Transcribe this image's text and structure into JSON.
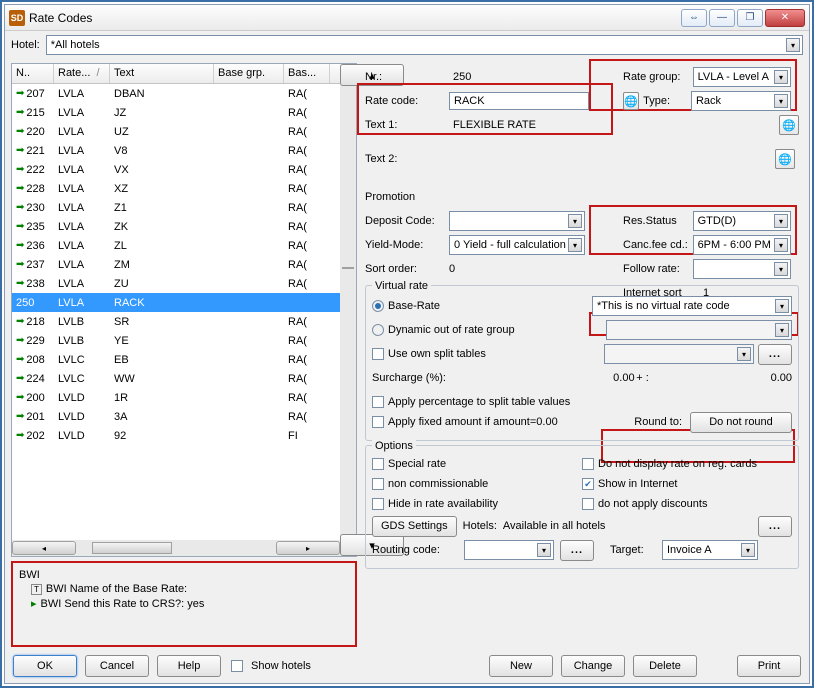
{
  "window": {
    "title": "Rate Codes"
  },
  "toolbar": {
    "hotel_label": "Hotel:",
    "hotel_value": "*All hotels"
  },
  "list": {
    "headers": {
      "nr": "N..",
      "rate": "Rate...",
      "sort": "/",
      "text": "Text",
      "basegrp": "Base grp.",
      "bas": "Bas..."
    },
    "rows": [
      {
        "nr": "207",
        "rate": "LVLA",
        "text": "DBAN",
        "bas": "RA("
      },
      {
        "nr": "215",
        "rate": "LVLA",
        "text": "JZ",
        "bas": "RA("
      },
      {
        "nr": "220",
        "rate": "LVLA",
        "text": "UZ",
        "bas": "RA("
      },
      {
        "nr": "221",
        "rate": "LVLA",
        "text": "V8",
        "bas": "RA("
      },
      {
        "nr": "222",
        "rate": "LVLA",
        "text": "VX",
        "bas": "RA("
      },
      {
        "nr": "228",
        "rate": "LVLA",
        "text": "XZ",
        "bas": "RA("
      },
      {
        "nr": "230",
        "rate": "LVLA",
        "text": "Z1",
        "bas": "RA("
      },
      {
        "nr": "235",
        "rate": "LVLA",
        "text": "ZK",
        "bas": "RA("
      },
      {
        "nr": "236",
        "rate": "LVLA",
        "text": "ZL",
        "bas": "RA("
      },
      {
        "nr": "237",
        "rate": "LVLA",
        "text": "ZM",
        "bas": "RA("
      },
      {
        "nr": "238",
        "rate": "LVLA",
        "text": "ZU",
        "bas": "RA("
      },
      {
        "nr": "250",
        "rate": "LVLA",
        "text": "RACK",
        "bas": "",
        "selected": true
      },
      {
        "nr": "218",
        "rate": "LVLB",
        "text": "SR",
        "bas": "RA("
      },
      {
        "nr": "229",
        "rate": "LVLB",
        "text": "YE",
        "bas": "RA("
      },
      {
        "nr": "208",
        "rate": "LVLC",
        "text": "EB",
        "bas": "RA("
      },
      {
        "nr": "224",
        "rate": "LVLC",
        "text": "WW",
        "bas": "RA("
      },
      {
        "nr": "200",
        "rate": "LVLD",
        "text": "1R",
        "bas": "RA("
      },
      {
        "nr": "201",
        "rate": "LVLD",
        "text": "3A",
        "bas": "RA("
      },
      {
        "nr": "202",
        "rate": "LVLD",
        "text": "92",
        "bas": "FI"
      }
    ]
  },
  "bwi": {
    "title": "BWI",
    "name_label": "BWI Name of the Base Rate:",
    "send_label": "BWI Send this Rate to CRS?: yes"
  },
  "form": {
    "nr_label": "Nr.:",
    "nr_value": "250",
    "rate_code_label": "Rate code:",
    "rate_code_value": "RACK",
    "text1_label": "Text 1:",
    "text1_value": "FLEXIBLE RATE",
    "text2_label": "Text 2:",
    "promotion_label": "Promotion",
    "deposit_label": "Deposit Code:",
    "yield_label": "Yield-Mode:",
    "yield_value": "0 Yield - full calculation",
    "sort_label": "Sort order:",
    "sort_value": "0",
    "rate_group_label": "Rate group:",
    "rate_group_value": "LVLA  - Level A",
    "type_label": "Type:",
    "type_value": "Rack",
    "res_status_label": "Res.Status",
    "res_status_value": "GTD(D)",
    "canc_fee_label": "Canc.fee cd.:",
    "canc_fee_value": "6PM  - 6:00 PM",
    "follow_rate_label": "Follow rate:",
    "internet_sort_label": "Internet sort",
    "internet_sort_value": "1"
  },
  "virtual": {
    "legend": "Virtual rate",
    "base_rate": "Base-Rate",
    "dynamic": "Dynamic out of rate group",
    "own_split": "Use own split tables",
    "surcharge_label": "Surcharge (%):",
    "surcharge_value": "0.00",
    "surcharge_plus": "+ :",
    "surcharge_plus_value": "0.00",
    "apply_pct": "Apply percentage to split table values",
    "apply_fixed": "Apply fixed amount if amount=0.00",
    "virtual_combo": "*This is no virtual rate code",
    "round_label": "Round to:",
    "round_value": "Do not round"
  },
  "options": {
    "legend": "Options",
    "special_rate": "Special rate",
    "non_comm": "non commissionable",
    "hide_avail": "Hide in rate availability",
    "no_reg_cards": "Do not display rate on reg. cards",
    "show_internet": "Show in Internet",
    "no_discounts": "do not apply discounts",
    "gds_btn": "GDS Settings",
    "hotels_label": "Hotels:",
    "hotels_value": "Available in all hotels",
    "routing_label": "Routing code:",
    "target_label": "Target:",
    "target_value": "Invoice A"
  },
  "footer": {
    "ok": "OK",
    "cancel": "Cancel",
    "help": "Help",
    "show_hotels": "Show hotels",
    "new": "New",
    "change": "Change",
    "delete": "Delete",
    "print": "Print"
  }
}
